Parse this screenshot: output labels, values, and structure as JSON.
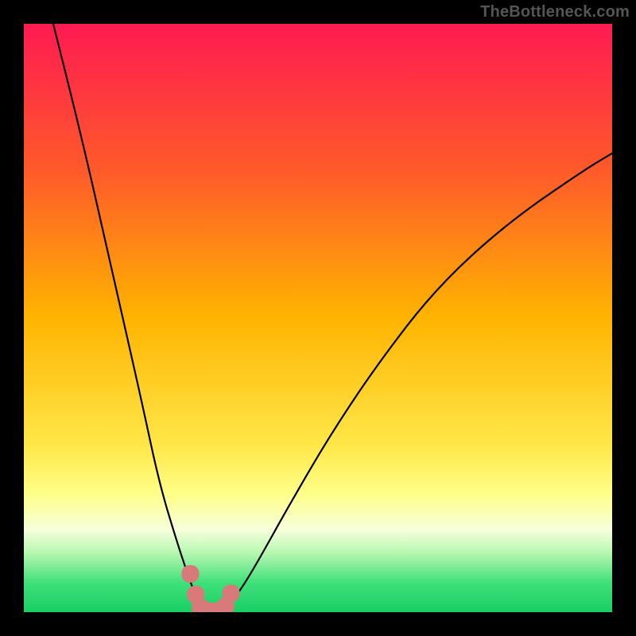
{
  "watermark": {
    "text": "TheBottleneck.com"
  },
  "chart_data": {
    "type": "line",
    "title": "",
    "xlabel": "",
    "ylabel": "",
    "xlim": [
      0,
      100
    ],
    "ylim": [
      0,
      100
    ],
    "gradient_stops": [
      {
        "offset": 0,
        "color": "#ff1a52"
      },
      {
        "offset": 25,
        "color": "#ff5a2a"
      },
      {
        "offset": 50,
        "color": "#ffb400"
      },
      {
        "offset": 72,
        "color": "#ffe84a"
      },
      {
        "offset": 80,
        "color": "#ffff8a"
      },
      {
        "offset": 86,
        "color": "#f6ffda"
      },
      {
        "offset": 90,
        "color": "#b6f7b0"
      },
      {
        "offset": 95,
        "color": "#3fe07a"
      },
      {
        "offset": 100,
        "color": "#19cf64"
      }
    ],
    "series": [
      {
        "name": "left-branch",
        "x": [
          5,
          10,
          15,
          20,
          23,
          26,
          28,
          29.5,
          30.5,
          31.2
        ],
        "y": [
          100,
          80,
          58,
          36,
          22,
          12,
          6,
          2,
          0.3,
          0
        ]
      },
      {
        "name": "right-branch",
        "x": [
          33.8,
          35,
          37,
          40,
          45,
          52,
          60,
          70,
          82,
          95,
          100
        ],
        "y": [
          0,
          1.5,
          4,
          9,
          18,
          30,
          42,
          55,
          66,
          75,
          78
        ]
      }
    ],
    "markers": {
      "name": "highlight-band",
      "points": [
        {
          "x": 28.3,
          "y": 6.5
        },
        {
          "x": 29.2,
          "y": 3.0
        },
        {
          "x": 30.0,
          "y": 0.8
        },
        {
          "x": 31.5,
          "y": 0.2
        },
        {
          "x": 33.0,
          "y": 0.2
        },
        {
          "x": 34.3,
          "y": 1.0
        },
        {
          "x": 35.2,
          "y": 3.2
        }
      ],
      "radius_px": 11
    }
  }
}
